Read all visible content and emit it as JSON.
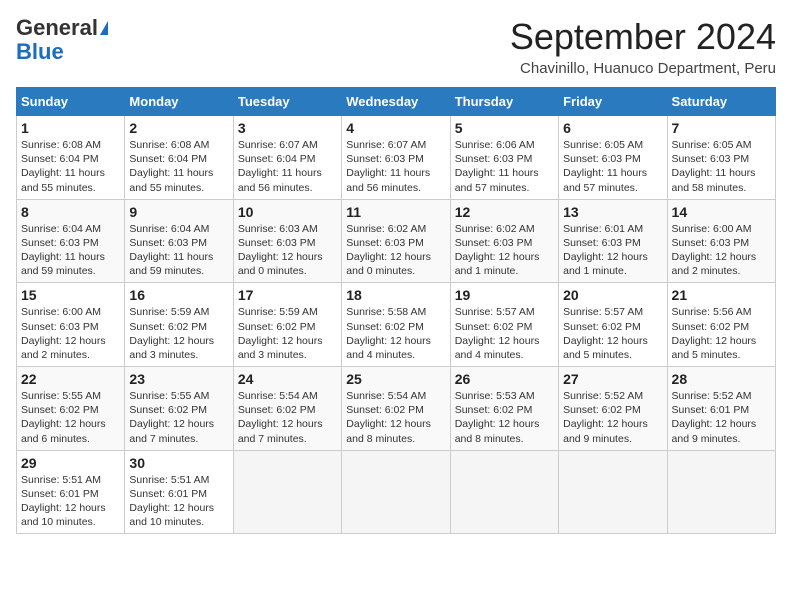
{
  "header": {
    "logo_general": "General",
    "logo_blue": "Blue",
    "month_title": "September 2024",
    "location": "Chavinillo, Huanuco Department, Peru"
  },
  "days_of_week": [
    "Sunday",
    "Monday",
    "Tuesday",
    "Wednesday",
    "Thursday",
    "Friday",
    "Saturday"
  ],
  "weeks": [
    [
      {
        "day": 1,
        "sunrise": "6:08 AM",
        "sunset": "6:04 PM",
        "daylight": "11 hours and 55 minutes"
      },
      {
        "day": 2,
        "sunrise": "6:08 AM",
        "sunset": "6:04 PM",
        "daylight": "11 hours and 55 minutes"
      },
      {
        "day": 3,
        "sunrise": "6:07 AM",
        "sunset": "6:04 PM",
        "daylight": "11 hours and 56 minutes"
      },
      {
        "day": 4,
        "sunrise": "6:07 AM",
        "sunset": "6:03 PM",
        "daylight": "11 hours and 56 minutes"
      },
      {
        "day": 5,
        "sunrise": "6:06 AM",
        "sunset": "6:03 PM",
        "daylight": "11 hours and 57 minutes"
      },
      {
        "day": 6,
        "sunrise": "6:05 AM",
        "sunset": "6:03 PM",
        "daylight": "11 hours and 57 minutes"
      },
      {
        "day": 7,
        "sunrise": "6:05 AM",
        "sunset": "6:03 PM",
        "daylight": "11 hours and 58 minutes"
      }
    ],
    [
      {
        "day": 8,
        "sunrise": "6:04 AM",
        "sunset": "6:03 PM",
        "daylight": "11 hours and 59 minutes"
      },
      {
        "day": 9,
        "sunrise": "6:04 AM",
        "sunset": "6:03 PM",
        "daylight": "11 hours and 59 minutes"
      },
      {
        "day": 10,
        "sunrise": "6:03 AM",
        "sunset": "6:03 PM",
        "daylight": "12 hours and 0 minutes"
      },
      {
        "day": 11,
        "sunrise": "6:02 AM",
        "sunset": "6:03 PM",
        "daylight": "12 hours and 0 minutes"
      },
      {
        "day": 12,
        "sunrise": "6:02 AM",
        "sunset": "6:03 PM",
        "daylight": "12 hours and 1 minute"
      },
      {
        "day": 13,
        "sunrise": "6:01 AM",
        "sunset": "6:03 PM",
        "daylight": "12 hours and 1 minute"
      },
      {
        "day": 14,
        "sunrise": "6:00 AM",
        "sunset": "6:03 PM",
        "daylight": "12 hours and 2 minutes"
      }
    ],
    [
      {
        "day": 15,
        "sunrise": "6:00 AM",
        "sunset": "6:03 PM",
        "daylight": "12 hours and 2 minutes"
      },
      {
        "day": 16,
        "sunrise": "5:59 AM",
        "sunset": "6:02 PM",
        "daylight": "12 hours and 3 minutes"
      },
      {
        "day": 17,
        "sunrise": "5:59 AM",
        "sunset": "6:02 PM",
        "daylight": "12 hours and 3 minutes"
      },
      {
        "day": 18,
        "sunrise": "5:58 AM",
        "sunset": "6:02 PM",
        "daylight": "12 hours and 4 minutes"
      },
      {
        "day": 19,
        "sunrise": "5:57 AM",
        "sunset": "6:02 PM",
        "daylight": "12 hours and 4 minutes"
      },
      {
        "day": 20,
        "sunrise": "5:57 AM",
        "sunset": "6:02 PM",
        "daylight": "12 hours and 5 minutes"
      },
      {
        "day": 21,
        "sunrise": "5:56 AM",
        "sunset": "6:02 PM",
        "daylight": "12 hours and 5 minutes"
      }
    ],
    [
      {
        "day": 22,
        "sunrise": "5:55 AM",
        "sunset": "6:02 PM",
        "daylight": "12 hours and 6 minutes"
      },
      {
        "day": 23,
        "sunrise": "5:55 AM",
        "sunset": "6:02 PM",
        "daylight": "12 hours and 7 minutes"
      },
      {
        "day": 24,
        "sunrise": "5:54 AM",
        "sunset": "6:02 PM",
        "daylight": "12 hours and 7 minutes"
      },
      {
        "day": 25,
        "sunrise": "5:54 AM",
        "sunset": "6:02 PM",
        "daylight": "12 hours and 8 minutes"
      },
      {
        "day": 26,
        "sunrise": "5:53 AM",
        "sunset": "6:02 PM",
        "daylight": "12 hours and 8 minutes"
      },
      {
        "day": 27,
        "sunrise": "5:52 AM",
        "sunset": "6:02 PM",
        "daylight": "12 hours and 9 minutes"
      },
      {
        "day": 28,
        "sunrise": "5:52 AM",
        "sunset": "6:01 PM",
        "daylight": "12 hours and 9 minutes"
      }
    ],
    [
      {
        "day": 29,
        "sunrise": "5:51 AM",
        "sunset": "6:01 PM",
        "daylight": "12 hours and 10 minutes"
      },
      {
        "day": 30,
        "sunrise": "5:51 AM",
        "sunset": "6:01 PM",
        "daylight": "12 hours and 10 minutes"
      },
      null,
      null,
      null,
      null,
      null
    ]
  ]
}
